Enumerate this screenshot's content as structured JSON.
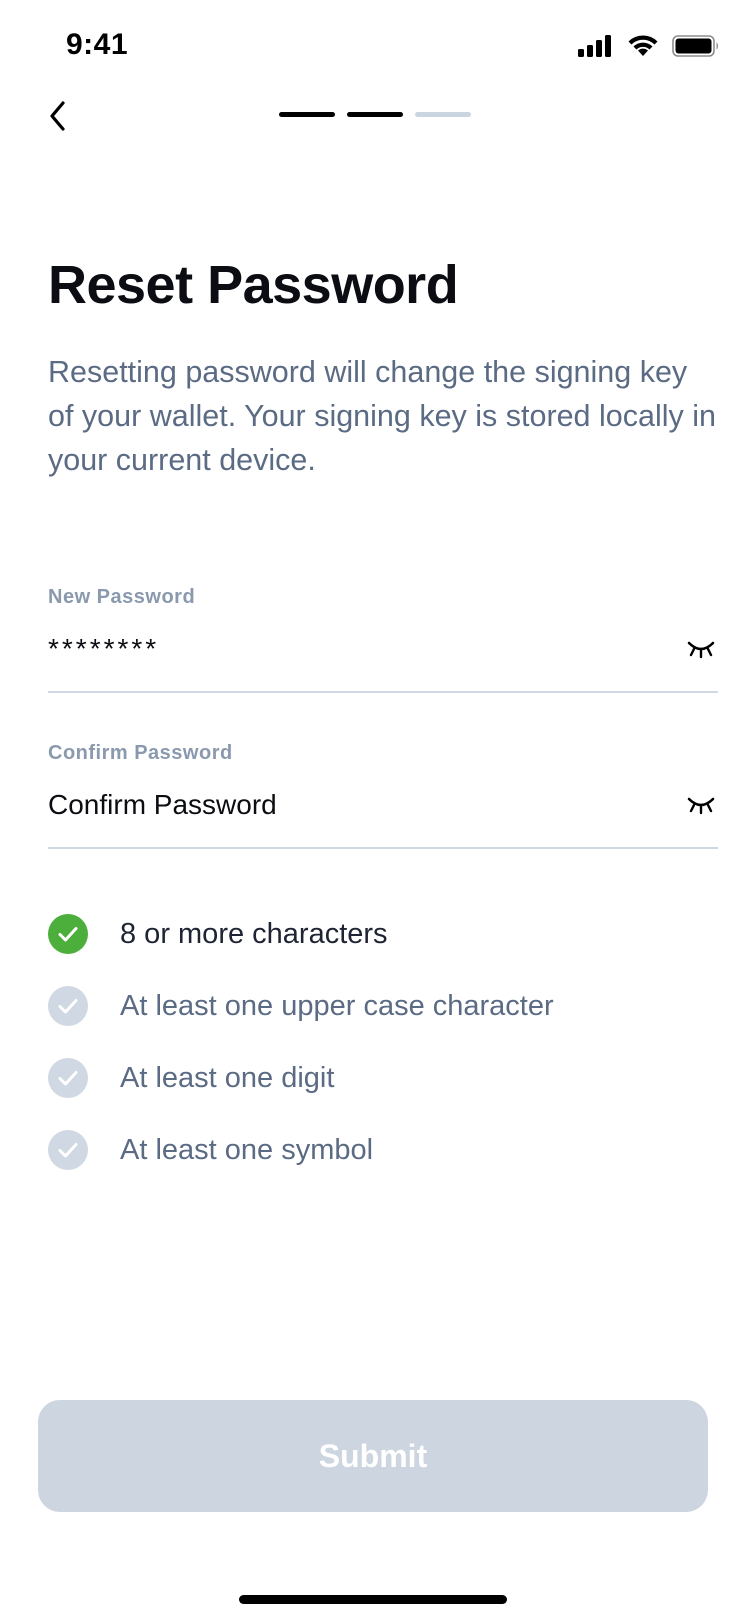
{
  "status_bar": {
    "time": "9:41"
  },
  "progress": {
    "total_steps": 3,
    "current_step": 2
  },
  "page": {
    "title": "Reset Password",
    "description": "Resetting password will change the signing key of your wallet. Your signing key is stored locally in your current device."
  },
  "form": {
    "new_password": {
      "label": "New Password",
      "value": "********"
    },
    "confirm_password": {
      "label": "Confirm Password",
      "placeholder": "Confirm Password"
    }
  },
  "requirements": [
    {
      "label": "8 or more characters",
      "met": true
    },
    {
      "label": "At least one upper case character",
      "met": false
    },
    {
      "label": "At least one digit",
      "met": false
    },
    {
      "label": "At least one symbol",
      "met": false
    }
  ],
  "submit": {
    "label": "Submit",
    "enabled": false
  },
  "colors": {
    "met": "#4caf3c",
    "unmet": "#cfd8e3",
    "button_disabled": "#cdd6e0"
  }
}
